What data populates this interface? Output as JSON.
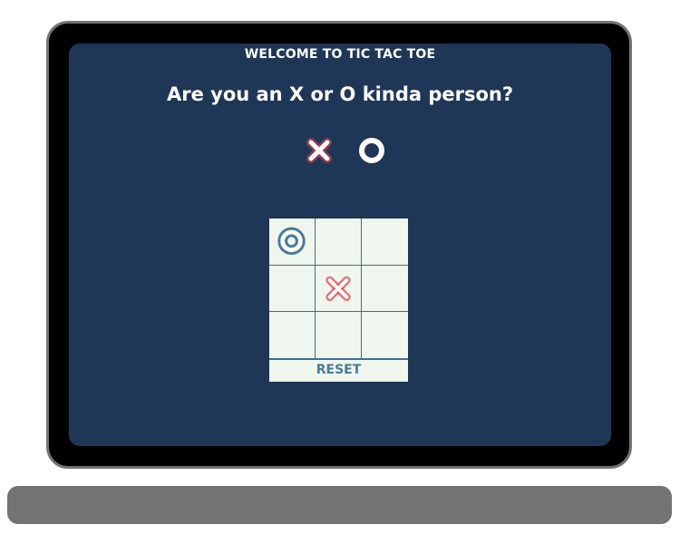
{
  "app": {
    "welcome_text": "WELCOME TO TIC TAC TOE",
    "question": "Are you an X or O kinda person?"
  },
  "choices": [
    {
      "mark": "X",
      "icon": "x-mark-icon"
    },
    {
      "mark": "O",
      "icon": "o-mark-icon"
    }
  ],
  "board": {
    "cells": [
      "O",
      "",
      "",
      "",
      "X",
      "",
      "",
      "",
      ""
    ]
  },
  "controls": {
    "reset_label": "RESET"
  },
  "colors": {
    "screen_bg": "#1f3757",
    "frame": "#000000",
    "frame_border": "#737373",
    "board_bg": "#eef6ee",
    "grid_line": "#3e6f90",
    "x_glow": "#e0404a",
    "o_accent": "#4a7a97"
  }
}
